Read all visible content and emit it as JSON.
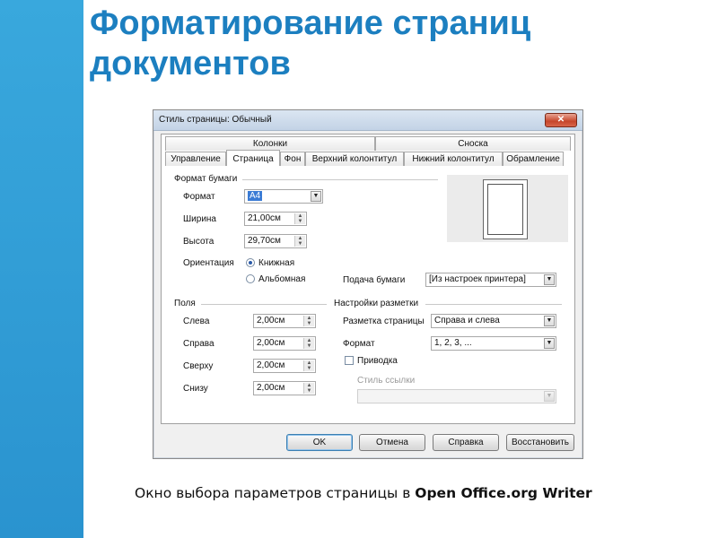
{
  "slide": {
    "title_line1": "Форматирование страниц",
    "title_line2": "документов",
    "caption_text": "Окно выбора параметров страницы в ",
    "caption_product": "Open Office.org Writer"
  },
  "dialog": {
    "title": "Стиль страницы: Обычный",
    "close_glyph": "✕",
    "tabs_top": [
      "Колонки",
      "Сноска"
    ],
    "tabs_bottom": [
      "Управление",
      "Страница",
      "Фон",
      "Верхний колонтитул",
      "Нижний колонтитул",
      "Обрамление"
    ],
    "active_tab": "Страница",
    "paper_format": {
      "group_label": "Формат бумаги",
      "format_label": "Формат",
      "format_value": "A4",
      "width_label": "Ширина",
      "width_value": "21,00см",
      "height_label": "Высота",
      "height_value": "29,70см",
      "orientation_label": "Ориентация",
      "portrait_label": "Книжная",
      "landscape_label": "Альбомная",
      "portrait_selected": true
    },
    "paper_source": {
      "label": "Подача бумаги",
      "value": "[Из настроек принтера]"
    },
    "margins": {
      "group_label": "Поля",
      "left_label": "Слева",
      "left_value": "2,00см",
      "right_label": "Справа",
      "right_value": "2,00см",
      "top_label": "Сверху",
      "top_value": "2,00см",
      "bottom_label": "Снизу",
      "bottom_value": "2,00см"
    },
    "layout": {
      "group_label": "Настройки разметки",
      "page_layout_label": "Разметка страницы",
      "page_layout_value": "Справа и слева",
      "format_label": "Формат",
      "format_value": "1, 2, 3, ...",
      "register_label": "Приводка",
      "register_checked": false,
      "ref_style_label": "Стиль ссылки",
      "ref_style_value": ""
    },
    "buttons": {
      "ok": "OK",
      "cancel": "Отмена",
      "help": "Справка",
      "reset": "Восстановить"
    }
  },
  "colors": {
    "left_bar": "#2a93cf",
    "title": "#1c7fc0"
  }
}
